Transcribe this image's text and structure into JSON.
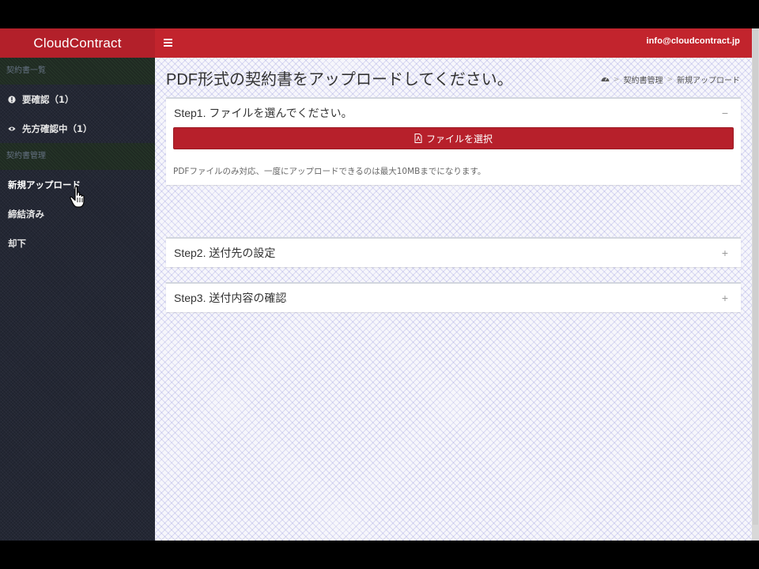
{
  "app": {
    "logo": "CloudContract"
  },
  "header": {
    "user_email": "info@cloudcontract.jp"
  },
  "sidebar": {
    "sections": [
      {
        "title": "契約書一覧",
        "items": [
          {
            "label": "要確認（1）",
            "icon": "exclamation-circle-icon"
          },
          {
            "label": "先方確認中（1）",
            "icon": "eye-icon"
          }
        ]
      },
      {
        "title": "契約書管理",
        "items": [
          {
            "label": "新規アップロード"
          },
          {
            "label": "締結済み"
          },
          {
            "label": "却下"
          }
        ]
      }
    ]
  },
  "main": {
    "page_title": "PDF形式の契約書をアップロードしてください。",
    "breadcrumb": [
      "契約書管理",
      "新規アップロード"
    ],
    "steps": [
      {
        "title": "Step1. ファイルを選んでください。",
        "expanded": true,
        "tool": "−",
        "button_label": "ファイルを選択",
        "help_text": "PDFファイルのみ対応、一度にアップロードできるのは最大10MBまでになります。"
      },
      {
        "title": "Step2. 送付先の設定",
        "expanded": false,
        "tool": "+"
      },
      {
        "title": "Step3. 送付内容の確認",
        "expanded": false,
        "tool": "+"
      }
    ]
  },
  "colors": {
    "brand_red": "#c2242d",
    "logo_red": "#b3202a",
    "sidebar_bg": "#232734"
  }
}
